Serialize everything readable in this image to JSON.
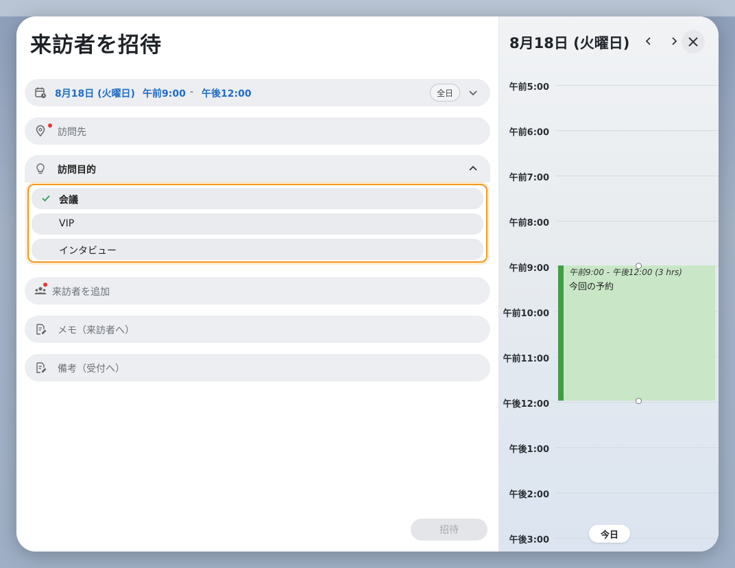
{
  "form": {
    "title": "来訪者を招待",
    "datetime": {
      "date": "8月18日 (火曜日)",
      "start": "午前9:00",
      "separator": "-",
      "end": "午後12:00",
      "allday_label": "全日"
    },
    "location_placeholder": "訪問先",
    "purpose": {
      "label": "訪問目的",
      "options": [
        {
          "label": "会議",
          "selected": true
        },
        {
          "label": "VIP",
          "selected": false
        },
        {
          "label": "インタビュー",
          "selected": false
        }
      ]
    },
    "add_visitor_placeholder": "来訪者を追加",
    "memo_placeholder": "メモ（来訪者へ）",
    "note_placeholder": "備考（受付へ）",
    "submit_label": "招待"
  },
  "calendar": {
    "date_title": "8月18日 (火曜日)",
    "hours": [
      "午前5:00",
      "午前6:00",
      "午前7:00",
      "午前8:00",
      "午前9:00",
      "午前10:00",
      "午前11:00",
      "午後12:00",
      "午後1:00",
      "午後2:00",
      "午後3:00"
    ],
    "event": {
      "time_range": "午前9:00 - 午後12:00 (3 hrs)",
      "title": "今回の予約"
    },
    "today_label": "今日"
  },
  "colors": {
    "accent_blue": "#1f6cc4",
    "dropdown_border": "#f29a1c",
    "event_fill": "#c9e7c6",
    "event_bar": "#3f9e44",
    "required_dot": "#e53935"
  }
}
